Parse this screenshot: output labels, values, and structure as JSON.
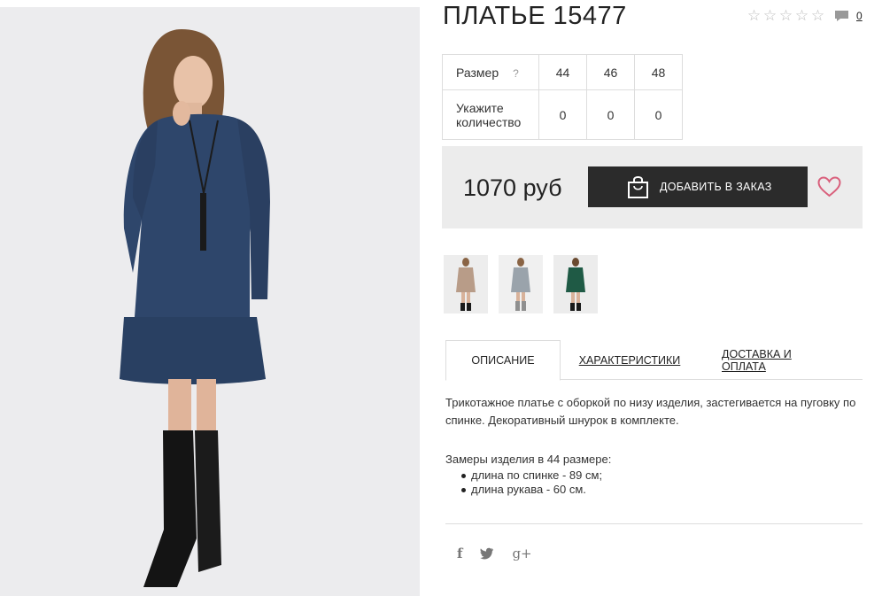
{
  "product": {
    "title": "ПЛАТЬЕ 15477",
    "comments_count": "0",
    "price": "1070 руб",
    "add_to_order": "ДОБАВИТЬ В ЗАКАЗ"
  },
  "size_table": {
    "size_label": "Размер",
    "help_glyph": "?",
    "qty_label": "Укажите количество",
    "sizes": [
      "44",
      "46",
      "48"
    ],
    "quantities": [
      "0",
      "0",
      "0"
    ]
  },
  "tabs": [
    {
      "label": "ОПИСАНИЕ"
    },
    {
      "label": "ХАРАКТЕРИСТИКИ"
    },
    {
      "label": "ДОСТАВКА И ОПЛАТА"
    }
  ],
  "description": {
    "text": "Трикотажное платье с оборкой по низу изделия, застегивается на пуговку по спинке. Декоративный шнурок в комплекте.",
    "measures_title": "Замеры изделия в 44 размере:",
    "measures": [
      "длина по спинке - 89 см;",
      "длина рукава - 60 см."
    ]
  },
  "social": {
    "facebook": "f",
    "google": "g+"
  },
  "colors": {
    "button_bg": "#2b2b2b",
    "heart": "#d9607c",
    "dress_blue": "#2e466b",
    "thumb1_dress": "#b89c88",
    "thumb2_dress": "#9aa3ab",
    "thumb3_dress": "#1f5a45"
  },
  "icons": [
    "star-icon",
    "comment-icon",
    "help-icon",
    "bag-icon",
    "heart-icon",
    "facebook-icon",
    "twitter-icon",
    "google-plus-icon"
  ]
}
